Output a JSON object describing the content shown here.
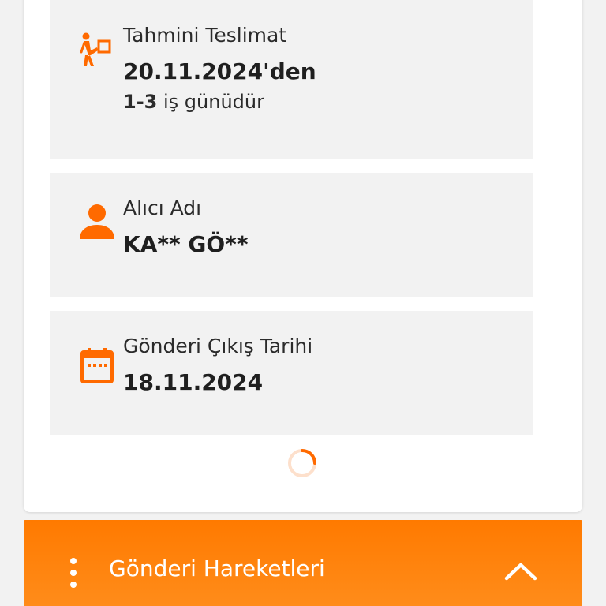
{
  "delivery": {
    "label": "Tahmini Teslimat",
    "date": "20.11.2024'den",
    "days_range": "1-3",
    "days_suffix": "iş günüdür",
    "icon": "delivery-person-icon"
  },
  "recipient": {
    "label": "Alıcı Adı",
    "name": "KA** GÖ**",
    "icon": "person-icon"
  },
  "shipment": {
    "label": "Gönderi Çıkış Tarihi",
    "date": "18.11.2024",
    "icon": "calendar-icon"
  },
  "footer": {
    "title": "Gönderi Hareketleri",
    "menu_icon": "more-vertical-icon",
    "expand_icon": "chevron-up-icon"
  },
  "colors": {
    "accent": "#ff6a00",
    "footer": "#ff7a00",
    "box_bg": "#f2f2f2"
  }
}
